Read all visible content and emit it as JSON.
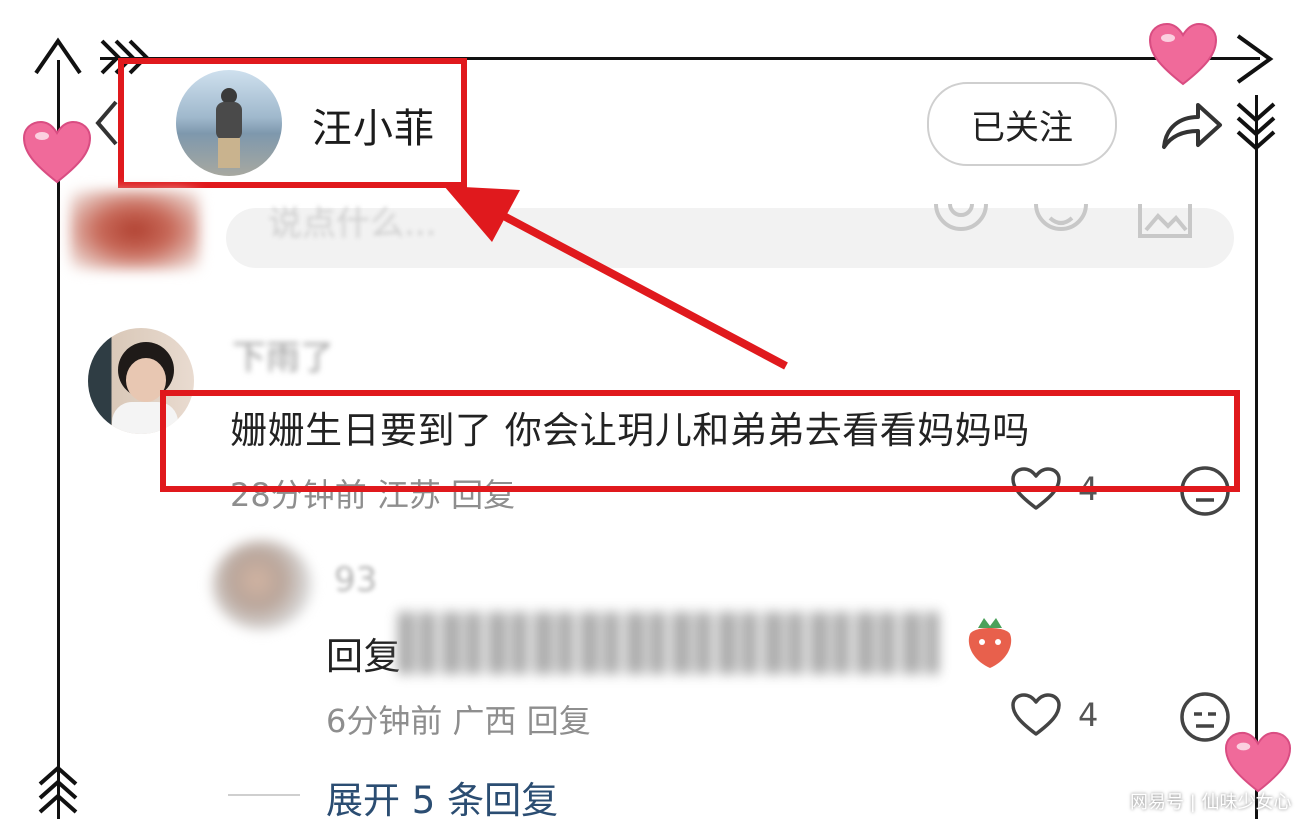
{
  "header": {
    "username": "汪小菲",
    "follow_label": "已关注"
  },
  "input": {
    "placeholder": "说点什么..."
  },
  "comment": {
    "username": "下雨了",
    "text": "姗姗生日要到了 你会让玥儿和弟弟去看看妈妈吗",
    "meta": "28分钟前 江苏 回复",
    "likes": "4"
  },
  "reply": {
    "username": "93",
    "text": "回复",
    "meta": "6分钟前 广西 回复",
    "likes": "4"
  },
  "expand_label": "展开 5 条回复",
  "watermark": "网易号 | 仙味少女心",
  "colors": {
    "annotation_red": "#e0191d",
    "heart_pink": "#f06a9a",
    "link_blue": "#2b4d72"
  },
  "icons": [
    "back-chevron-icon",
    "share-icon",
    "at-icon",
    "emoji-icon",
    "image-icon",
    "heart-outline-icon",
    "dislike-face-icon",
    "heart-sticker-icon",
    "arrow-icon",
    "chevron-stack-icon",
    "strawberry-emoji-icon"
  ]
}
